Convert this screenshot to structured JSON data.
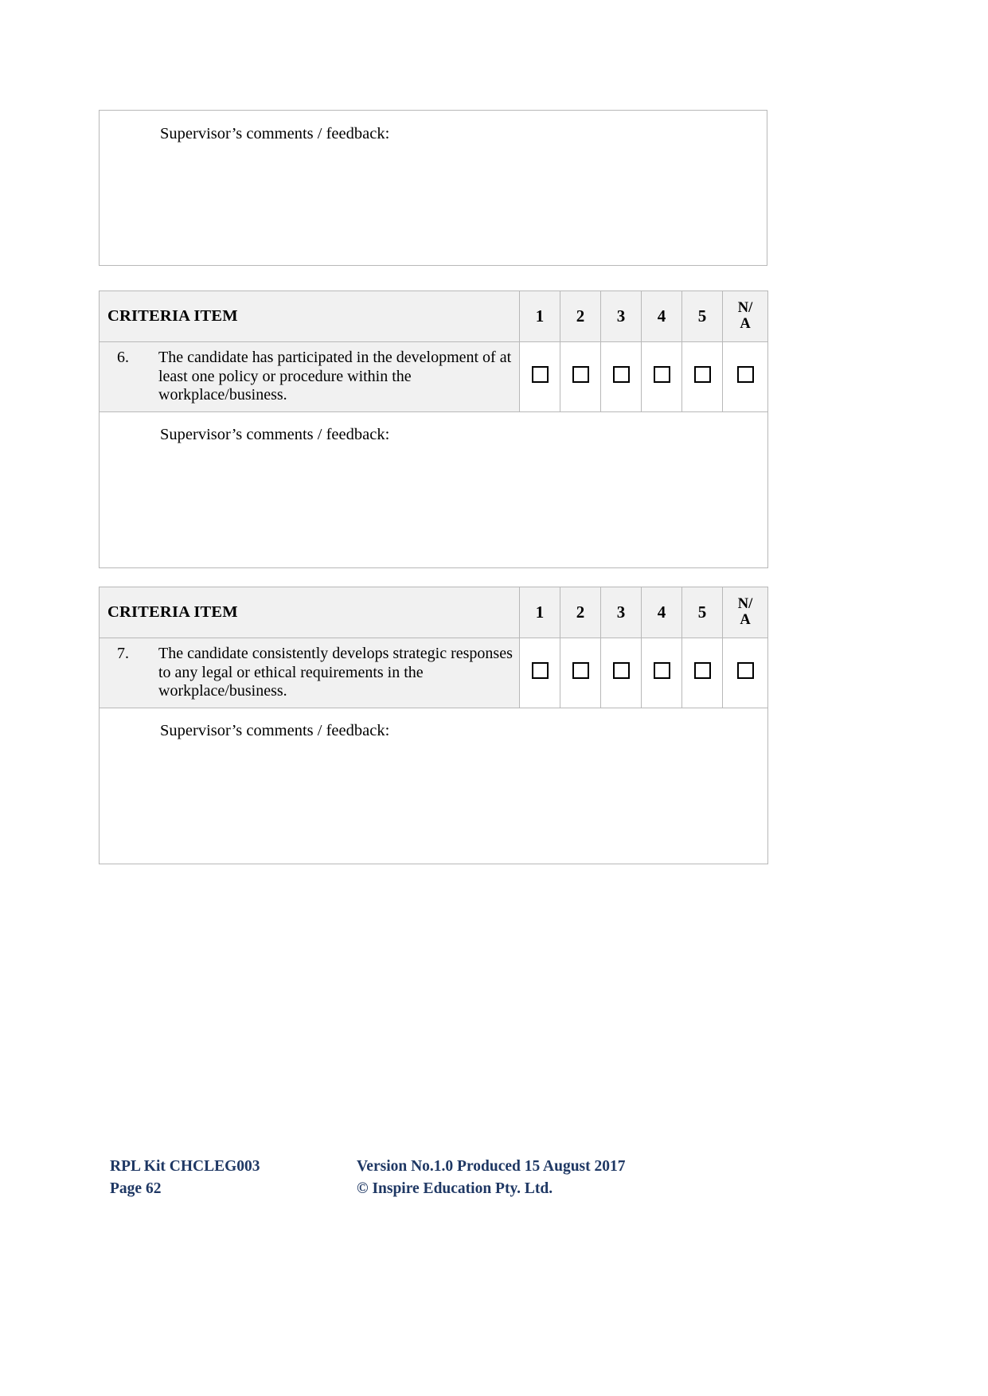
{
  "document": {
    "top_comment_box": {
      "label": "Supervisor’s comments / feedback:"
    },
    "rating_columns": [
      "1",
      "2",
      "3",
      "4",
      "5"
    ],
    "na_column": {
      "line1": "N/",
      "line2": "A"
    },
    "criteria_header": "CRITERIA ITEM",
    "checkbox_icon": "empty-checkbox",
    "blocks": [
      {
        "header": "CRITERIA ITEM",
        "item_number": "6.",
        "item_text": "The candidate has participated in the development of at least one policy or procedure within the workplace/business.",
        "comments_label": "Supervisor’s comments / feedback:"
      },
      {
        "header": "CRITERIA ITEM",
        "item_number": "7.",
        "item_text": "The candidate consistently develops strategic responses to any legal or ethical requirements in the workplace/business.",
        "comments_label": "Supervisor’s comments / feedback:"
      }
    ],
    "footer": {
      "kit": "RPL Kit CHCLEG003",
      "page": "Page 62",
      "version": "Version No.1.0 Produced 15 August 2017",
      "copyright": "© Inspire Education Pty. Ltd.",
      "color": "#1F3864"
    }
  }
}
